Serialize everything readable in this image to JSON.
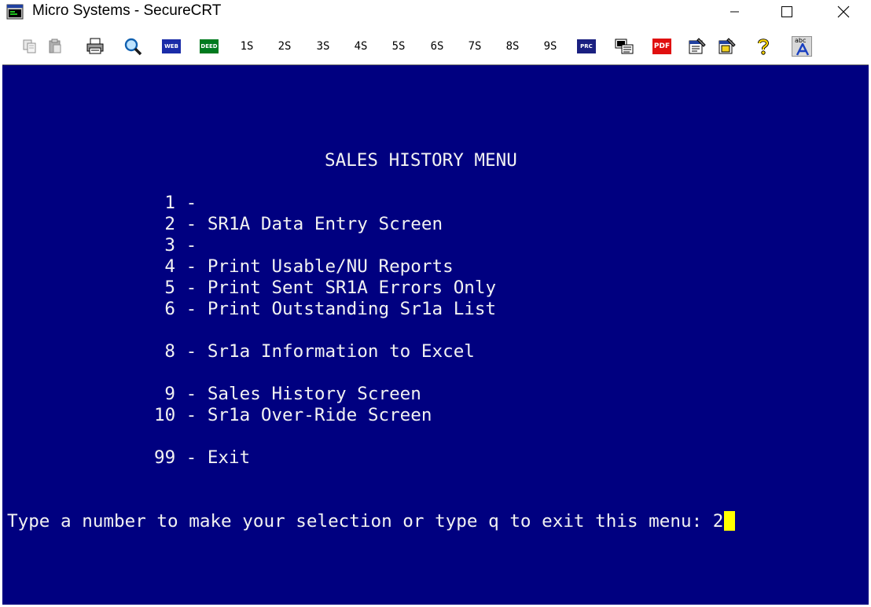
{
  "window": {
    "title": "Micro Systems - SecureCRT",
    "app_icon": "securecrt-icon",
    "controls": {
      "minimize_icon": "minimize-icon",
      "maximize_icon": "maximize-icon",
      "close_icon": "close-icon"
    }
  },
  "toolbar": {
    "session_buttons": [
      "1S",
      "2S",
      "3S",
      "4S",
      "5S",
      "6S",
      "7S",
      "8S",
      "9S"
    ],
    "web_label": "WEB",
    "deed_label": "DEED",
    "proc_label": "PRC",
    "pdf_label": "PDF",
    "abc_label": "abc",
    "icons": [
      "copy-icon",
      "paste-icon",
      "print-icon",
      "find-icon",
      "web-icon",
      "deed-icon",
      "proc-icon",
      "log-session-icon",
      "pdf-icon",
      "session-options-icon",
      "global-options-icon",
      "help-icon",
      "spell-icon"
    ],
    "colors": {
      "web": "#1a2ca8",
      "deed": "#007a1e",
      "proc": "#1a2080",
      "pdf": "#e01010"
    }
  },
  "terminal": {
    "background": "#000080",
    "foreground": "#f2f2f2",
    "cursor_color": "#ffff00",
    "title": "SALES HISTORY MENU",
    "menu_items": [
      {
        "number": "1",
        "dash": "-",
        "label": ""
      },
      {
        "number": "2",
        "dash": "-",
        "label": "SR1A Data Entry Screen"
      },
      {
        "number": "3",
        "dash": "-",
        "label": ""
      },
      {
        "number": "4",
        "dash": "-",
        "label": "Print Usable/NU Reports"
      },
      {
        "number": "5",
        "dash": "-",
        "label": "Print Sent SR1A Errors Only"
      },
      {
        "number": "6",
        "dash": "-",
        "label": "Print Outstanding Sr1a List"
      },
      {
        "number": "8",
        "dash": "-",
        "label": "Sr1a Information to Excel"
      },
      {
        "number": "9",
        "dash": "-",
        "label": "Sales History Screen"
      },
      {
        "number": "10",
        "dash": "-",
        "label": "Sr1a Over-Ride Screen"
      },
      {
        "number": "99",
        "dash": "-",
        "label": "Exit"
      }
    ],
    "prompt": "Type a number to make your selection or type q to exit this menu: ",
    "input_value": "2"
  }
}
